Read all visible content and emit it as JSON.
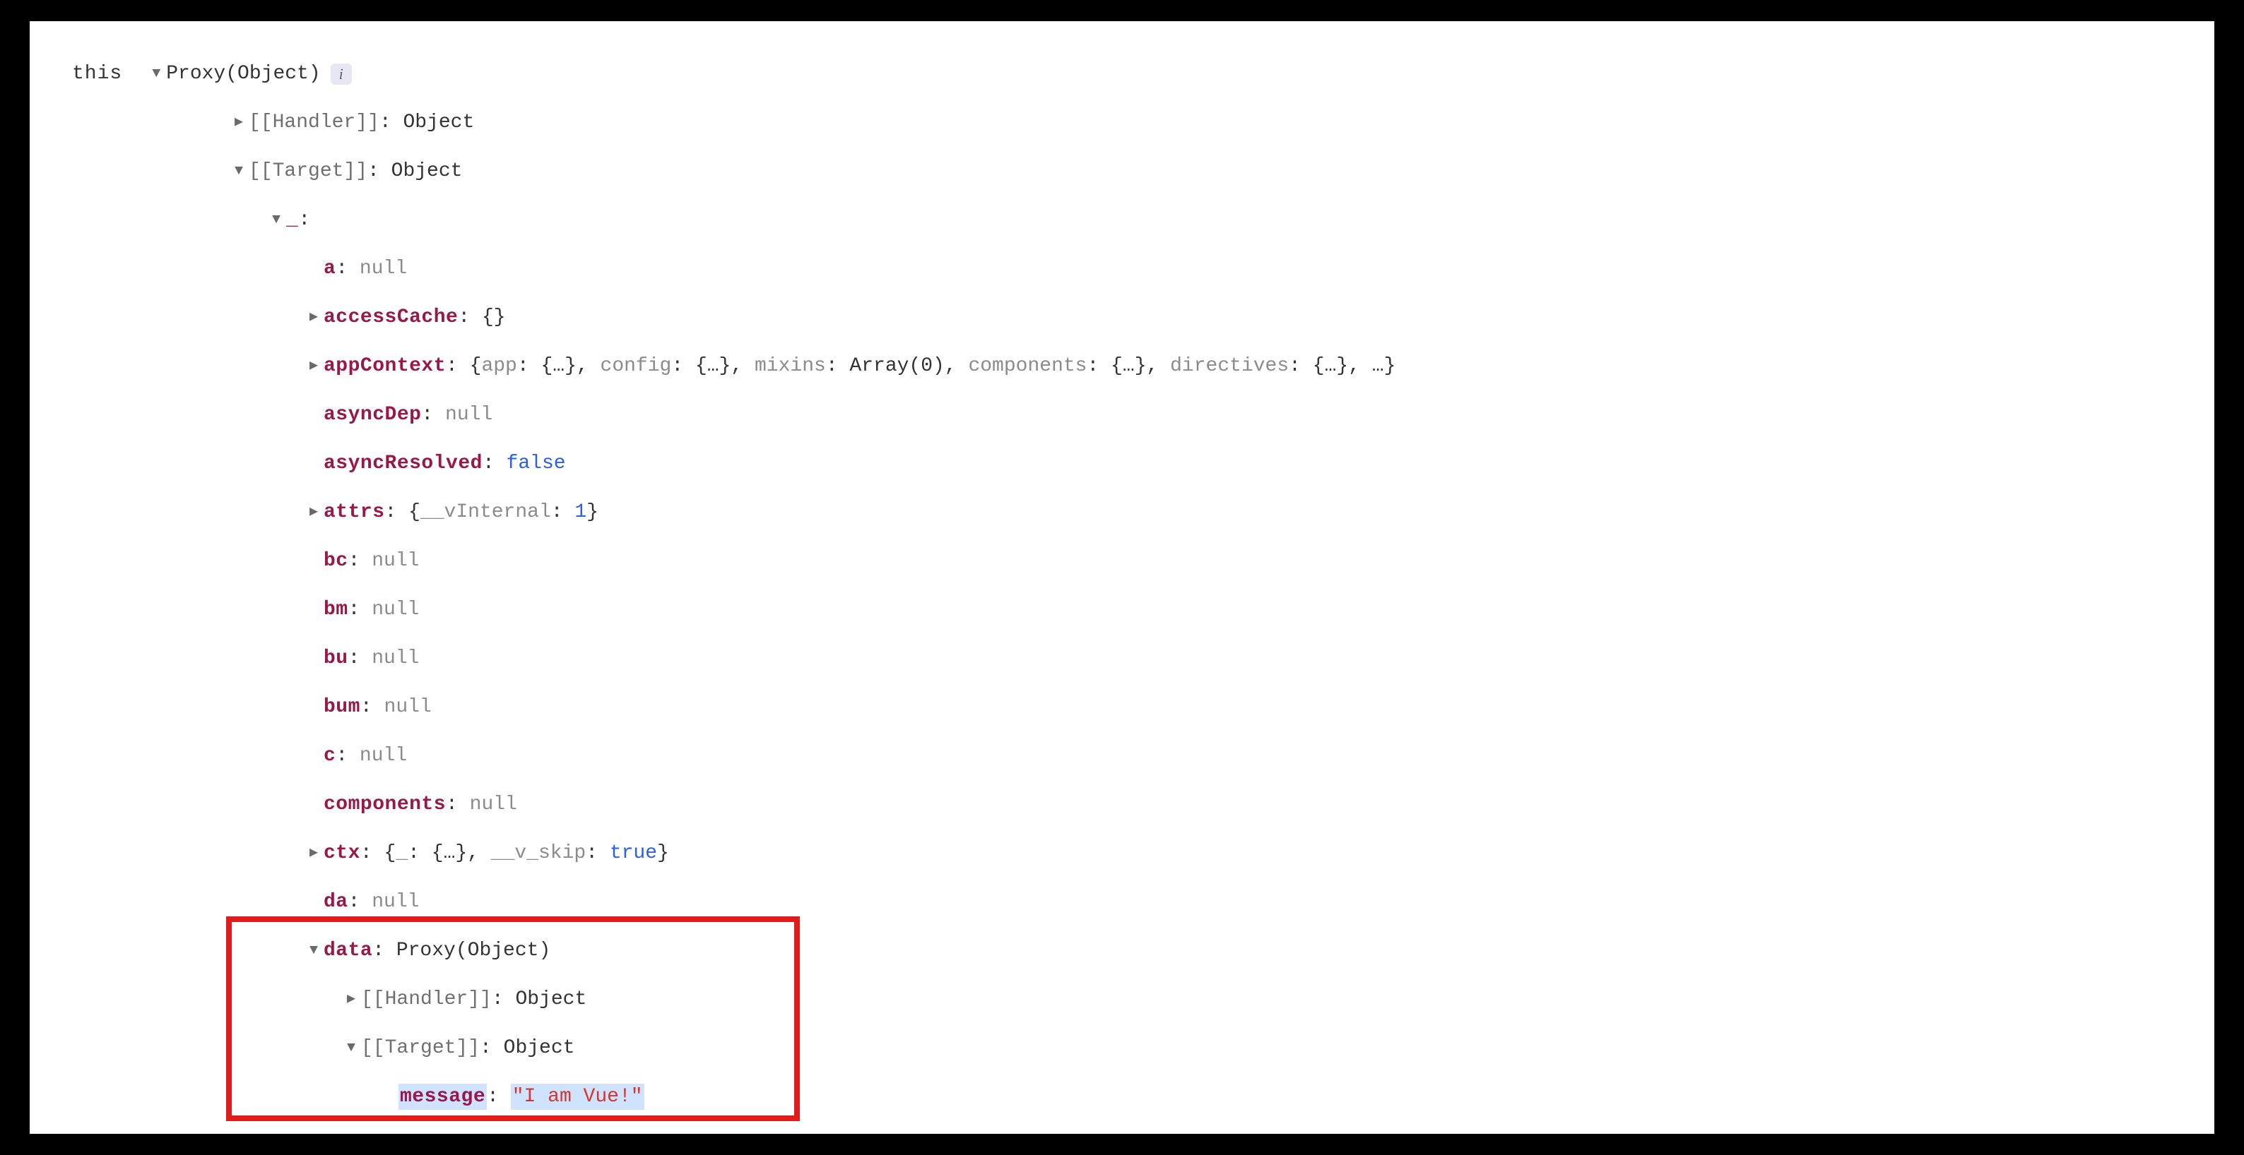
{
  "root": {
    "this_label": "this",
    "proxy_label": "Proxy(Object)",
    "info_i": "i"
  },
  "handler1": {
    "key": "[[Handler]]",
    "val": "Object"
  },
  "target1": {
    "key": "[[Target]]",
    "val": "Object"
  },
  "underscore": {
    "key": "_",
    "colon": ":"
  },
  "props": {
    "a": {
      "key": "a",
      "val": "null"
    },
    "accessCache": {
      "key": "accessCache",
      "val": "{}"
    },
    "appContext": {
      "key": "appContext",
      "prefix": "{",
      "app_k": "app",
      "app_v": "{…}",
      "config_k": "config",
      "config_v": "{…}",
      "mixins_k": "mixins",
      "mixins_v": "Array(0)",
      "components_k": "components",
      "components_v": "{…}",
      "directives_k": "directives",
      "directives_v": "{…}",
      "suffix": ", …}"
    },
    "asyncDep": {
      "key": "asyncDep",
      "val": "null"
    },
    "asyncResolved": {
      "key": "asyncResolved",
      "val": "false"
    },
    "attrs": {
      "key": "attrs",
      "prefix": "{",
      "ik": "__vInternal",
      "iv": "1",
      "suffix": "}"
    },
    "bc": {
      "key": "bc",
      "val": "null"
    },
    "bm": {
      "key": "bm",
      "val": "null"
    },
    "bu": {
      "key": "bu",
      "val": "null"
    },
    "bum": {
      "key": "bum",
      "val": "null"
    },
    "c": {
      "key": "c",
      "val": "null"
    },
    "components": {
      "key": "components",
      "val": "null"
    },
    "ctx": {
      "key": "ctx",
      "prefix": "{",
      "u_k": "_",
      "u_v": "{…}",
      "skip_k": "__v_skip",
      "skip_v": "true",
      "suffix": "}"
    },
    "da": {
      "key": "da",
      "val": "null"
    },
    "data": {
      "key": "data",
      "val": "Proxy(Object)"
    },
    "data_handler": {
      "key": "[[Handler]]",
      "val": "Object"
    },
    "data_target": {
      "key": "[[Target]]",
      "val": "Object"
    },
    "message": {
      "key": "message",
      "val": "\"I am Vue!\""
    }
  }
}
